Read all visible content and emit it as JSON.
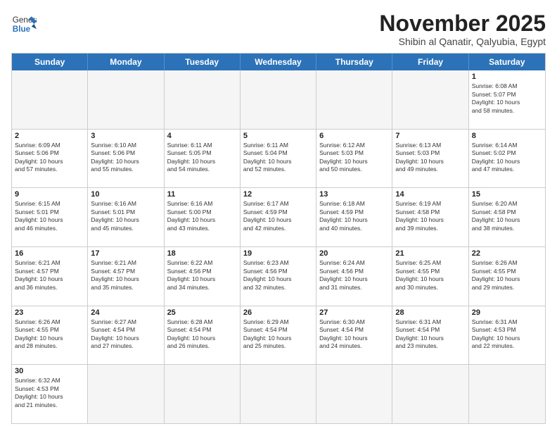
{
  "header": {
    "logo_general": "General",
    "logo_blue": "Blue",
    "month": "November 2025",
    "location": "Shibin al Qanatir, Qalyubia, Egypt"
  },
  "weekdays": [
    "Sunday",
    "Monday",
    "Tuesday",
    "Wednesday",
    "Thursday",
    "Friday",
    "Saturday"
  ],
  "rows": [
    [
      {
        "day": "",
        "empty": true
      },
      {
        "day": "",
        "empty": true
      },
      {
        "day": "",
        "empty": true
      },
      {
        "day": "",
        "empty": true
      },
      {
        "day": "",
        "empty": true
      },
      {
        "day": "",
        "empty": true
      },
      {
        "day": "1",
        "info": "Sunrise: 6:08 AM\nSunset: 5:07 PM\nDaylight: 10 hours\nand 58 minutes."
      }
    ],
    [
      {
        "day": "2",
        "info": "Sunrise: 6:09 AM\nSunset: 5:06 PM\nDaylight: 10 hours\nand 57 minutes."
      },
      {
        "day": "3",
        "info": "Sunrise: 6:10 AM\nSunset: 5:06 PM\nDaylight: 10 hours\nand 55 minutes."
      },
      {
        "day": "4",
        "info": "Sunrise: 6:11 AM\nSunset: 5:05 PM\nDaylight: 10 hours\nand 54 minutes."
      },
      {
        "day": "5",
        "info": "Sunrise: 6:11 AM\nSunset: 5:04 PM\nDaylight: 10 hours\nand 52 minutes."
      },
      {
        "day": "6",
        "info": "Sunrise: 6:12 AM\nSunset: 5:03 PM\nDaylight: 10 hours\nand 50 minutes."
      },
      {
        "day": "7",
        "info": "Sunrise: 6:13 AM\nSunset: 5:03 PM\nDaylight: 10 hours\nand 49 minutes."
      },
      {
        "day": "8",
        "info": "Sunrise: 6:14 AM\nSunset: 5:02 PM\nDaylight: 10 hours\nand 47 minutes."
      }
    ],
    [
      {
        "day": "9",
        "info": "Sunrise: 6:15 AM\nSunset: 5:01 PM\nDaylight: 10 hours\nand 46 minutes."
      },
      {
        "day": "10",
        "info": "Sunrise: 6:16 AM\nSunset: 5:01 PM\nDaylight: 10 hours\nand 45 minutes."
      },
      {
        "day": "11",
        "info": "Sunrise: 6:16 AM\nSunset: 5:00 PM\nDaylight: 10 hours\nand 43 minutes."
      },
      {
        "day": "12",
        "info": "Sunrise: 6:17 AM\nSunset: 4:59 PM\nDaylight: 10 hours\nand 42 minutes."
      },
      {
        "day": "13",
        "info": "Sunrise: 6:18 AM\nSunset: 4:59 PM\nDaylight: 10 hours\nand 40 minutes."
      },
      {
        "day": "14",
        "info": "Sunrise: 6:19 AM\nSunset: 4:58 PM\nDaylight: 10 hours\nand 39 minutes."
      },
      {
        "day": "15",
        "info": "Sunrise: 6:20 AM\nSunset: 4:58 PM\nDaylight: 10 hours\nand 38 minutes."
      }
    ],
    [
      {
        "day": "16",
        "info": "Sunrise: 6:21 AM\nSunset: 4:57 PM\nDaylight: 10 hours\nand 36 minutes."
      },
      {
        "day": "17",
        "info": "Sunrise: 6:21 AM\nSunset: 4:57 PM\nDaylight: 10 hours\nand 35 minutes."
      },
      {
        "day": "18",
        "info": "Sunrise: 6:22 AM\nSunset: 4:56 PM\nDaylight: 10 hours\nand 34 minutes."
      },
      {
        "day": "19",
        "info": "Sunrise: 6:23 AM\nSunset: 4:56 PM\nDaylight: 10 hours\nand 32 minutes."
      },
      {
        "day": "20",
        "info": "Sunrise: 6:24 AM\nSunset: 4:56 PM\nDaylight: 10 hours\nand 31 minutes."
      },
      {
        "day": "21",
        "info": "Sunrise: 6:25 AM\nSunset: 4:55 PM\nDaylight: 10 hours\nand 30 minutes."
      },
      {
        "day": "22",
        "info": "Sunrise: 6:26 AM\nSunset: 4:55 PM\nDaylight: 10 hours\nand 29 minutes."
      }
    ],
    [
      {
        "day": "23",
        "info": "Sunrise: 6:26 AM\nSunset: 4:55 PM\nDaylight: 10 hours\nand 28 minutes."
      },
      {
        "day": "24",
        "info": "Sunrise: 6:27 AM\nSunset: 4:54 PM\nDaylight: 10 hours\nand 27 minutes."
      },
      {
        "day": "25",
        "info": "Sunrise: 6:28 AM\nSunset: 4:54 PM\nDaylight: 10 hours\nand 26 minutes."
      },
      {
        "day": "26",
        "info": "Sunrise: 6:29 AM\nSunset: 4:54 PM\nDaylight: 10 hours\nand 25 minutes."
      },
      {
        "day": "27",
        "info": "Sunrise: 6:30 AM\nSunset: 4:54 PM\nDaylight: 10 hours\nand 24 minutes."
      },
      {
        "day": "28",
        "info": "Sunrise: 6:31 AM\nSunset: 4:54 PM\nDaylight: 10 hours\nand 23 minutes."
      },
      {
        "day": "29",
        "info": "Sunrise: 6:31 AM\nSunset: 4:53 PM\nDaylight: 10 hours\nand 22 minutes."
      }
    ],
    [
      {
        "day": "30",
        "info": "Sunrise: 6:32 AM\nSunset: 4:53 PM\nDaylight: 10 hours\nand 21 minutes."
      },
      {
        "day": "",
        "empty": true
      },
      {
        "day": "",
        "empty": true
      },
      {
        "day": "",
        "empty": true
      },
      {
        "day": "",
        "empty": true
      },
      {
        "day": "",
        "empty": true
      },
      {
        "day": "",
        "empty": true
      }
    ]
  ]
}
